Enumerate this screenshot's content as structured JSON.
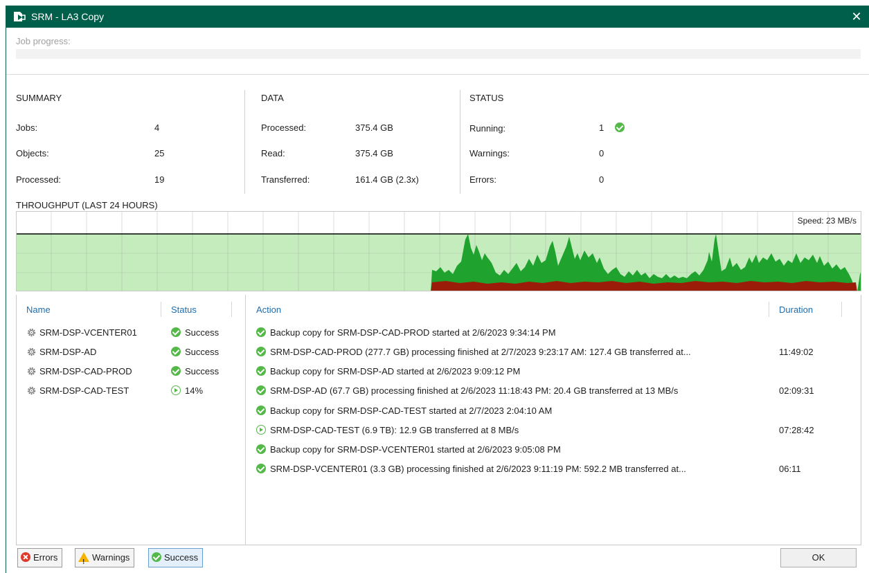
{
  "window": {
    "title": "SRM - LA3 Copy",
    "close_glyph": "✕"
  },
  "job_progress": {
    "label": "Job progress:",
    "percent": 0
  },
  "summary": {
    "heading": "SUMMARY",
    "rows": [
      {
        "label": "Jobs:",
        "value": "4"
      },
      {
        "label": "Objects:",
        "value": "25"
      },
      {
        "label": "Processed:",
        "value": "19"
      }
    ]
  },
  "data": {
    "heading": "DATA",
    "rows": [
      {
        "label": "Processed:",
        "value": "375.4 GB"
      },
      {
        "label": "Read:",
        "value": "375.4 GB"
      },
      {
        "label": "Transferred:",
        "value": "161.4 GB (2.3x)"
      }
    ]
  },
  "status": {
    "heading": "STATUS",
    "rows": [
      {
        "label": "Running:",
        "value": "1"
      },
      {
        "label": "Warnings:",
        "value": "0"
      },
      {
        "label": "Errors:",
        "value": "0"
      }
    ]
  },
  "throughput": {
    "heading": "THROUGHPUT (LAST 24 HOURS)",
    "speed_label": "Speed: 23 MB/s",
    "colors": {
      "background": "#c4ecbd",
      "processing": "#1fa32e",
      "transfer": "#9b1c08",
      "speed_line": "#000000"
    }
  },
  "objects_table": {
    "headers": {
      "name": "Name",
      "status": "Status"
    },
    "rows": [
      {
        "name": "SRM-DSP-VCENTER01",
        "status": "Success",
        "state": "success"
      },
      {
        "name": "SRM-DSP-AD",
        "status": "Success",
        "state": "success"
      },
      {
        "name": "SRM-DSP-CAD-PROD",
        "status": "Success",
        "state": "success"
      },
      {
        "name": "SRM-DSP-CAD-TEST",
        "status": "14%",
        "state": "running"
      }
    ]
  },
  "actions_table": {
    "headers": {
      "action": "Action",
      "duration": "Duration"
    },
    "rows": [
      {
        "text": "Backup copy for SRM-DSP-CAD-PROD started at 2/6/2023 9:34:14 PM",
        "duration": "",
        "state": "success"
      },
      {
        "text": "SRM-DSP-CAD-PROD (277.7 GB) processing finished at 2/7/2023 9:23:17 AM: 127.4 GB transferred at...",
        "duration": "11:49:02",
        "state": "success"
      },
      {
        "text": "Backup copy for SRM-DSP-AD started at 2/6/2023 9:09:12 PM",
        "duration": "",
        "state": "success"
      },
      {
        "text": "SRM-DSP-AD (67.7 GB) processing finished at 2/6/2023 11:18:43 PM: 20.4 GB transferred at 13 MB/s",
        "duration": "02:09:31",
        "state": "success"
      },
      {
        "text": "Backup copy for SRM-DSP-CAD-TEST started at 2/7/2023 2:04:10 AM",
        "duration": "",
        "state": "success"
      },
      {
        "text": "SRM-DSP-CAD-TEST (6.9 TB): 12.9 GB transferred at 8 MB/s",
        "duration": "07:28:42",
        "state": "running"
      },
      {
        "text": "Backup copy for SRM-DSP-VCENTER01 started at 2/6/2023 9:05:08 PM",
        "duration": "",
        "state": "success"
      },
      {
        "text": "SRM-DSP-VCENTER01 (3.3 GB) processing finished at 2/6/2023 9:11:19 PM: 592.2 MB transferred at...",
        "duration": "06:11",
        "state": "success"
      }
    ]
  },
  "footer": {
    "errors_label": "Errors",
    "warnings_label": "Warnings",
    "success_label": "Success",
    "ok_label": "OK"
  }
}
